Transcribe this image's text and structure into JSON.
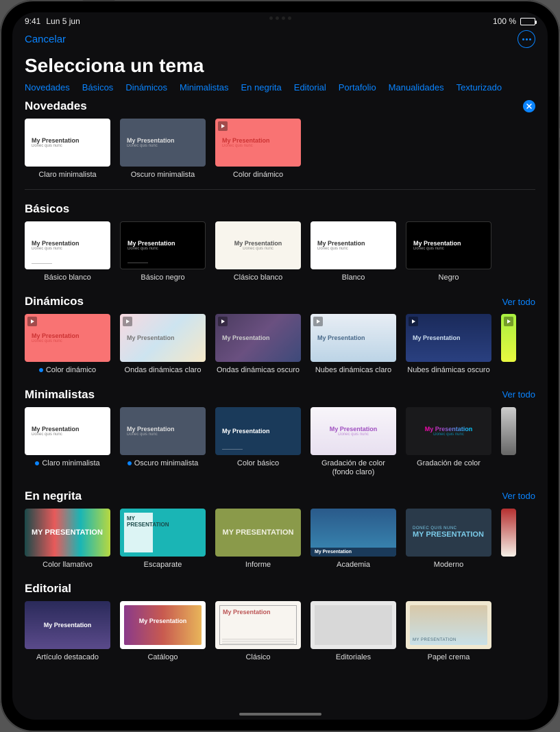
{
  "status": {
    "time": "9:41",
    "date": "Lun 5 jun",
    "battery": "100 %"
  },
  "topbar": {
    "cancel": "Cancelar"
  },
  "title": "Selecciona un tema",
  "categories": [
    "Novedades",
    "Básicos",
    "Dinámicos",
    "Minimalistas",
    "En negrita",
    "Editorial",
    "Portafolio",
    "Manualidades",
    "Texturizado"
  ],
  "see_all": "Ver todo",
  "thumb_text": {
    "title": "My Presentation",
    "caps": "MY PRESENTATION",
    "sub": "Donec quis nunc"
  },
  "sections": {
    "novedades": {
      "title": "Novedades",
      "items": [
        {
          "name": "Claro minimalista"
        },
        {
          "name": "Oscuro minimalista"
        },
        {
          "name": "Color dinámico"
        }
      ]
    },
    "basicos": {
      "title": "Básicos",
      "items": [
        {
          "name": "Básico blanco"
        },
        {
          "name": "Básico negro"
        },
        {
          "name": "Clásico blanco"
        },
        {
          "name": "Blanco"
        },
        {
          "name": "Negro"
        }
      ]
    },
    "dinamicos": {
      "title": "Dinámicos",
      "items": [
        {
          "name": "Color dinámico"
        },
        {
          "name": "Ondas dinámicas claro"
        },
        {
          "name": "Ondas dinámicas oscuro"
        },
        {
          "name": "Nubes dinámicas claro"
        },
        {
          "name": "Nubes dinámicas oscuro"
        }
      ]
    },
    "minimalistas": {
      "title": "Minimalistas",
      "items": [
        {
          "name": "Claro minimalista"
        },
        {
          "name": "Oscuro minimalista"
        },
        {
          "name": "Color básico"
        },
        {
          "name": "Gradación de color (fondo claro)"
        },
        {
          "name": "Gradación de color"
        }
      ]
    },
    "negrita": {
      "title": "En negrita",
      "items": [
        {
          "name": "Color llamativo"
        },
        {
          "name": "Escaparate"
        },
        {
          "name": "Informe"
        },
        {
          "name": "Academia"
        },
        {
          "name": "Moderno"
        }
      ]
    },
    "editorial": {
      "title": "Editorial",
      "items": [
        {
          "name": "Artículo destacado"
        },
        {
          "name": "Catálogo"
        },
        {
          "name": "Clásico"
        },
        {
          "name": "Editoriales"
        },
        {
          "name": "Papel crema"
        }
      ]
    }
  }
}
